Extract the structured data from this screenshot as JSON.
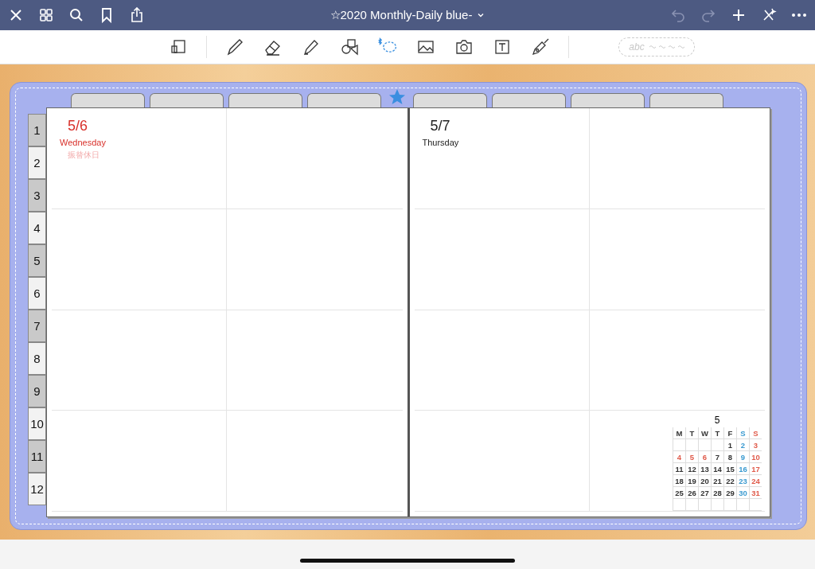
{
  "top_bar": {
    "title": "☆2020 Monthly-Daily blue-"
  },
  "toolbar": {
    "handwriting_placeholder": "abc"
  },
  "month_tabs": [
    {
      "label": "1"
    },
    {
      "label": "2"
    },
    {
      "label": "3"
    },
    {
      "label": "4"
    },
    {
      "label": "5"
    },
    {
      "label": "6"
    },
    {
      "label": "7"
    },
    {
      "label": "8"
    },
    {
      "label": "9"
    },
    {
      "label": "10"
    },
    {
      "label": "11"
    },
    {
      "label": "12"
    }
  ],
  "pages": [
    {
      "date": "5/6",
      "weekday": "Wednesday",
      "holiday": "振替休日",
      "color": "#d8302a"
    },
    {
      "date": "5/7",
      "weekday": "Thursday",
      "color": "#222222"
    }
  ],
  "mini_calendar": {
    "month": "5",
    "headers": [
      {
        "label": "M",
        "color": "#333333"
      },
      {
        "label": "T",
        "color": "#333333"
      },
      {
        "label": "W",
        "color": "#333333"
      },
      {
        "label": "T",
        "color": "#333333"
      },
      {
        "label": "F",
        "color": "#333333"
      },
      {
        "label": "S",
        "color": "#3a9ad0"
      },
      {
        "label": "S",
        "color": "#e05a4a"
      }
    ],
    "weeks": [
      {
        "kind": "first",
        "days": [
          {
            "day": "1",
            "color": "#333333"
          },
          {
            "day": "2",
            "color": "#3a9ad0"
          },
          {
            "day": "3",
            "color": "#e05a4a"
          }
        ]
      },
      {
        "kind": "full",
        "days": [
          {
            "day": "4",
            "color": "#e05a4a"
          },
          {
            "day": "5",
            "color": "#e05a4a"
          },
          {
            "day": "6",
            "color": "#e05a4a"
          },
          {
            "day": "7",
            "color": "#333333"
          },
          {
            "day": "8",
            "color": "#333333"
          },
          {
            "day": "9",
            "color": "#3a9ad0"
          },
          {
            "day": "10",
            "color": "#e05a4a"
          }
        ]
      },
      {
        "kind": "full",
        "days": [
          {
            "day": "11",
            "color": "#333333"
          },
          {
            "day": "12",
            "color": "#333333"
          },
          {
            "day": "13",
            "color": "#333333"
          },
          {
            "day": "14",
            "color": "#333333"
          },
          {
            "day": "15",
            "color": "#333333"
          },
          {
            "day": "16",
            "color": "#3a9ad0"
          },
          {
            "day": "17",
            "color": "#e05a4a"
          }
        ]
      },
      {
        "kind": "full",
        "days": [
          {
            "day": "18",
            "color": "#333333"
          },
          {
            "day": "19",
            "color": "#333333"
          },
          {
            "day": "20",
            "color": "#333333"
          },
          {
            "day": "21",
            "color": "#333333"
          },
          {
            "day": "22",
            "color": "#333333"
          },
          {
            "day": "23",
            "color": "#3a9ad0"
          },
          {
            "day": "24",
            "color": "#e05a4a"
          }
        ]
      },
      {
        "kind": "full",
        "days": [
          {
            "day": "25",
            "color": "#333333"
          },
          {
            "day": "26",
            "color": "#333333"
          },
          {
            "day": "27",
            "color": "#333333"
          },
          {
            "day": "28",
            "color": "#333333"
          },
          {
            "day": "29",
            "color": "#333333"
          },
          {
            "day": "30",
            "color": "#3a9ad0"
          },
          {
            "day": "31",
            "color": "#e05a4a"
          }
        ]
      }
    ]
  }
}
